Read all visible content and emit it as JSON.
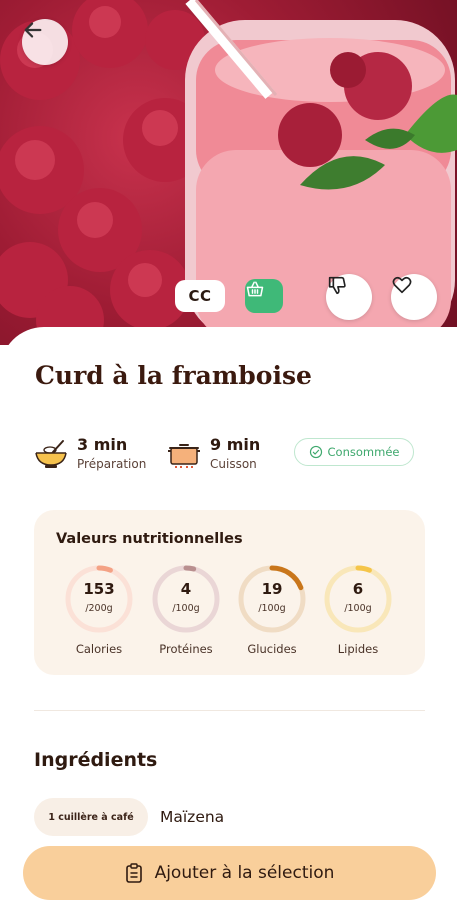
{
  "recipe": {
    "title": "Curd à la framboise",
    "badge_cc": "CC"
  },
  "meta": {
    "prep_value": "3 min",
    "prep_label": "Préparation",
    "cook_value": "9 min",
    "cook_label": "Cuisson",
    "status_label": "Consommée"
  },
  "nutrition": {
    "title": "Valeurs nutritionnelles",
    "items": [
      {
        "value": "153",
        "unit": "/200g",
        "label": "Calories",
        "color": "#f4a285",
        "track": "#fbe1d7",
        "fill": 0.06
      },
      {
        "value": "4",
        "unit": "/100g",
        "label": "Protéines",
        "color": "#b98f8f",
        "track": "#ead6d6",
        "fill": 0.04
      },
      {
        "value": "19",
        "unit": "/100g",
        "label": "Glucides",
        "color": "#c9761b",
        "track": "#f0dcc4",
        "fill": 0.19
      },
      {
        "value": "6",
        "unit": "/100g",
        "label": "Lipides",
        "color": "#f5c54a",
        "track": "#f9e7b9",
        "fill": 0.06
      }
    ]
  },
  "ingredients": {
    "title": "Ingrédients",
    "items": [
      {
        "quantity": "1 cuillère à café",
        "name": "Maïzena"
      }
    ]
  },
  "cta": {
    "label": "Ajouter à la sélection"
  },
  "icons": {
    "back": "arrow-left-icon",
    "basket": "basket-icon",
    "dislike": "thumbs-down-icon",
    "favorite": "heart-icon",
    "whisk": "whisk-bowl-icon",
    "pot": "cooking-pot-icon",
    "check": "check-circle-icon",
    "clipboard": "clipboard-icon"
  },
  "colors": {
    "accent_green": "#3fb978",
    "cta_background": "#f9cf9b",
    "nutrition_background": "#fbf3ea"
  }
}
